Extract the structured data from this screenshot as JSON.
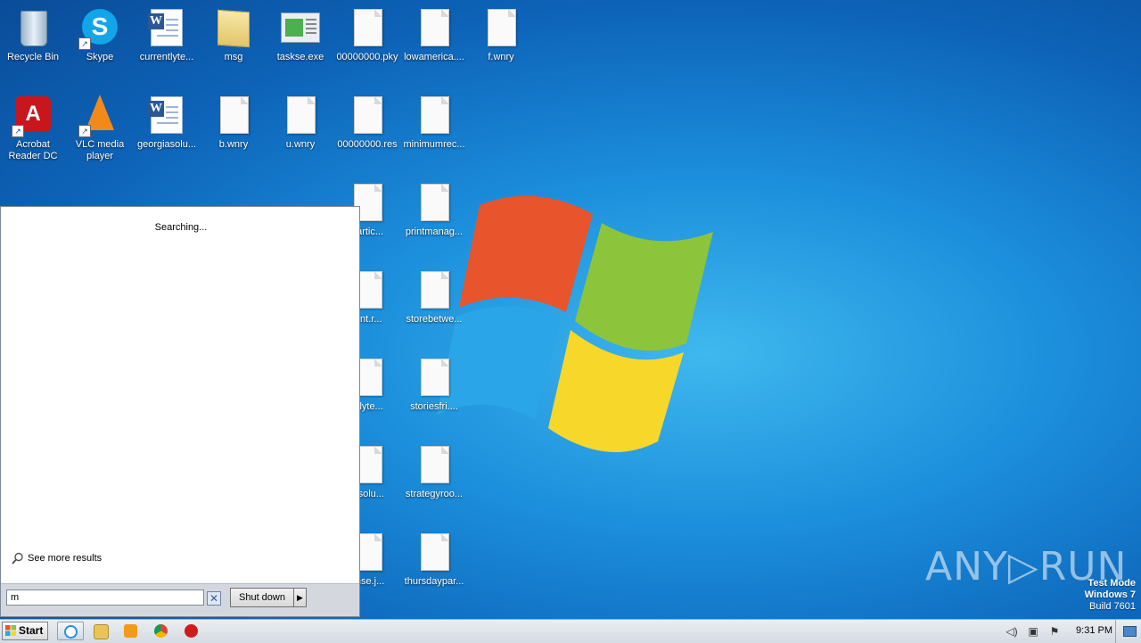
{
  "desktop_icons": [
    {
      "label": "Recycle Bin",
      "kind": "recycle"
    },
    {
      "label": "Skype",
      "kind": "skype"
    },
    {
      "label": "currentlyte...",
      "kind": "word"
    },
    {
      "label": "msg",
      "kind": "folder"
    },
    {
      "label": "taskse.exe",
      "kind": "exe"
    },
    {
      "label": "00000000.pky",
      "kind": "doc"
    },
    {
      "label": "lowamerica....",
      "kind": "doc"
    },
    {
      "label": "f.wnry",
      "kind": "doc"
    },
    {
      "label": "Acrobat Reader DC",
      "kind": "acrobat"
    },
    {
      "label": "VLC media player",
      "kind": "vlc"
    },
    {
      "label": "georgiasolu...",
      "kind": "word"
    },
    {
      "label": "b.wnry",
      "kind": "doc"
    },
    {
      "label": "u.wnry",
      "kind": "doc"
    },
    {
      "label": "00000000.res",
      "kind": "doc"
    },
    {
      "label": "minimumrec...",
      "kind": "doc"
    },
    {
      "label": "dartic...",
      "kind": "doc"
    },
    {
      "label": "printmanag...",
      "kind": "doc"
    },
    {
      "label": "ient.r...",
      "kind": "doc"
    },
    {
      "label": "storebetwe...",
      "kind": "doc"
    },
    {
      "label": "ntlyte...",
      "kind": "doc"
    },
    {
      "label": "storiesfri....",
      "kind": "doc"
    },
    {
      "label": "iasolu...",
      "kind": "doc"
    },
    {
      "label": "strategyroo...",
      "kind": "doc"
    },
    {
      "label": "ense.j...",
      "kind": "doc"
    },
    {
      "label": "thursdaypar...",
      "kind": "doc"
    }
  ],
  "start_menu": {
    "status": "Searching...",
    "see_more": "See more results",
    "search_value": "m",
    "shutdown_label": "Shut down"
  },
  "taskbar": {
    "start_label": "Start",
    "apps": [
      "internet-explorer-icon",
      "explorer-folder-icon",
      "media-player-icon",
      "chrome-icon",
      "opera-icon"
    ],
    "clock": "9:31 PM"
  },
  "watermark": {
    "line1": "Test Mode",
    "line2": "Windows 7",
    "line3": "Build 7601",
    "brand": "ANY▷RUN"
  },
  "colors": {
    "desktop": "#1c8fdc",
    "taskbar": "#dfe4ea",
    "logo_red": "#e8542b",
    "logo_green": "#8cc43c",
    "logo_blue": "#2aa6e8",
    "logo_yellow": "#f6d72a"
  }
}
